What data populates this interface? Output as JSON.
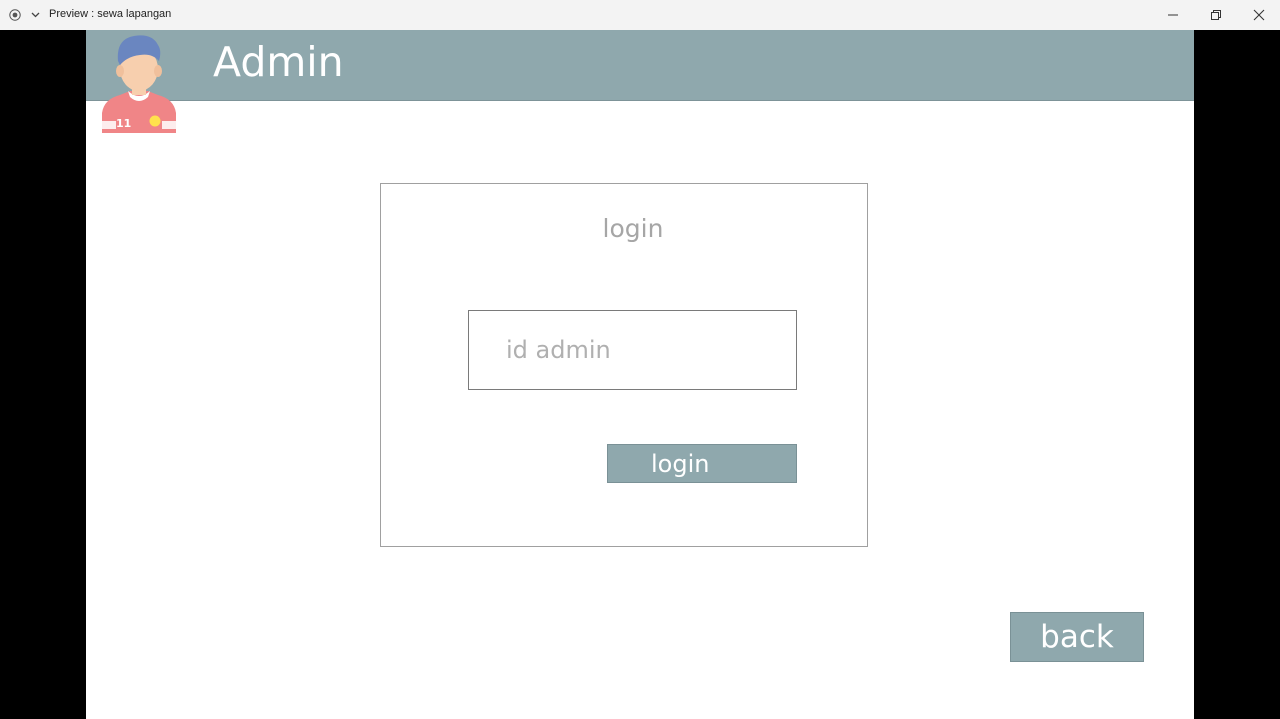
{
  "window": {
    "title": "Preview : sewa lapangan"
  },
  "header": {
    "title": "Admin",
    "avatar_icon": "soccer-player-avatar-icon",
    "jersey_number": "11",
    "background_color": "#8fa8ad"
  },
  "login_panel": {
    "title": "login",
    "id_field": {
      "placeholder": "id admin",
      "value": ""
    },
    "login_button_label": "login"
  },
  "back_button_label": "back",
  "colors": {
    "accent": "#8fa8ad",
    "muted_text": "#a6a6a6"
  }
}
